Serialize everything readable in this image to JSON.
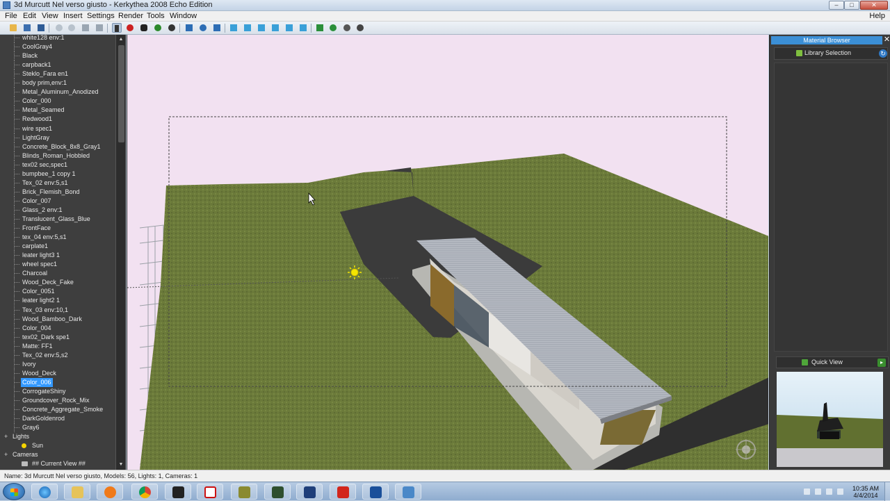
{
  "window": {
    "title": "3d Murcutt Nel verso giusto - Kerkythea 2008 Echo Edition",
    "minimize": "–",
    "maximize": "□",
    "close": "✕"
  },
  "menu": {
    "items": [
      "File",
      "Edit",
      "View",
      "Insert",
      "Settings",
      "Render",
      "Tools",
      "Window"
    ],
    "help": "Help"
  },
  "toolbar": {
    "icons": [
      "open-icon",
      "save-icon",
      "save-as-icon",
      "undo-icon",
      "redo-icon",
      "cut-icon",
      "copy-icon",
      "select-icon",
      "record-icon",
      "pan-icon",
      "rotate-icon",
      "zoom-icon",
      "home-icon",
      "fit-icon",
      "camera-icon",
      "cube-front-icon",
      "cube-back-icon",
      "cube-top-icon",
      "cube-bottom-icon",
      "cube-left-icon",
      "cube-right-icon",
      "render-icon",
      "material-icon",
      "gear-icon",
      "sphere-icon"
    ]
  },
  "scene_tree": {
    "materials": [
      "white128 env:1",
      "CoolGray4",
      "Black",
      "carpback1",
      "Steklo_Fara en1",
      "body prim,env:1",
      "Metal_Aluminum_Anodized",
      "Color_000",
      "Metal_Seamed",
      "Redwood1",
      "wire spec1",
      "LightGray",
      "Concrete_Block_8x8_Gray1",
      "Blinds_Roman_Hobbled",
      "tex02 sec,spec1",
      "bumpbee_1 copy 1",
      "Tex_02 env:5,s1",
      "Brick_Flemish_Bond",
      "Color_007",
      "Glass_2 env:1",
      "Translucent_Glass_Blue",
      "FrontFace",
      "tex_04 env:5,s1",
      "carplate1",
      "leater light3 1",
      "wheel spec1",
      "Charcoal",
      "Wood_Deck_Fake",
      "Color_0051",
      "leater light2 1",
      "Tex_03 env:10,1",
      "Wood_Bamboo_Dark",
      "Color_004",
      "tex02_Dark spe1",
      "Matte: FF1",
      "Tex_02 env:5,s2",
      "Ivory",
      "Wood_Deck",
      "Color_006",
      "CorrogateShiny",
      "Groundcover_Rock_Mix",
      "Concrete_Aggregate_Smoke",
      "DarkGoldenrod",
      "Gray6"
    ],
    "selected": "Color_006",
    "lights_label": "Lights",
    "lights": [
      "Sun"
    ],
    "cameras_label": "Cameras",
    "cameras": [
      "## Current View ##"
    ],
    "expander_open": "−",
    "expander": "+"
  },
  "material_browser": {
    "title": "Material Browser",
    "close": "✕",
    "library_label": "Library Selection",
    "refresh": "↻",
    "quick_view_label": "Quick View",
    "quick_view_btn": "▸"
  },
  "status_bar": {
    "text": "Name: 3d Murcutt Nel verso giusto, Models: 56, Lights: 1, Cameras: 1"
  },
  "taskbar": {
    "apps": [
      "internet-explorer-icon",
      "file-explorer-icon",
      "media-player-icon",
      "chrome-icon",
      "inkscape-icon",
      "acrobat-icon",
      "sketchup-ext-icon",
      "ebook-icon",
      "autocad-icon",
      "sketchup-icon",
      "kerkythea-icon",
      "remote-desktop-icon"
    ],
    "time": "10:35 AM",
    "date": "4/4/2014"
  },
  "colors": {
    "sky": "#f2e1f1",
    "grass": "#6b7a3a",
    "road": "#3b3b3b",
    "selection": "#3399ff",
    "panel": "#3e3e3e"
  }
}
